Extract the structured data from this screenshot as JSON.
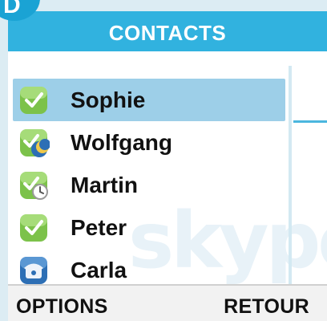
{
  "header": {
    "title": "CONTACTS"
  },
  "badge": {
    "letter": "D"
  },
  "watermark": {
    "text": "skype"
  },
  "contacts": [
    {
      "name": "Sophie",
      "status_icon": "online-check-icon",
      "selected": true
    },
    {
      "name": "Wolfgang",
      "status_icon": "away-moon-icon",
      "selected": false
    },
    {
      "name": "Martin",
      "status_icon": "idle-clock-icon",
      "selected": false
    },
    {
      "name": "Peter",
      "status_icon": "online-check-icon",
      "selected": false
    },
    {
      "name": "Carla",
      "status_icon": "phone-icon",
      "selected": false
    }
  ],
  "softkeys": {
    "left": "OPTIONS",
    "right": "RETOUR"
  },
  "colors": {
    "header_bg": "#31b2df",
    "selected_bg": "#9dcfe8",
    "online_green": "#7cc24a",
    "phone_blue": "#2d6fb5"
  }
}
